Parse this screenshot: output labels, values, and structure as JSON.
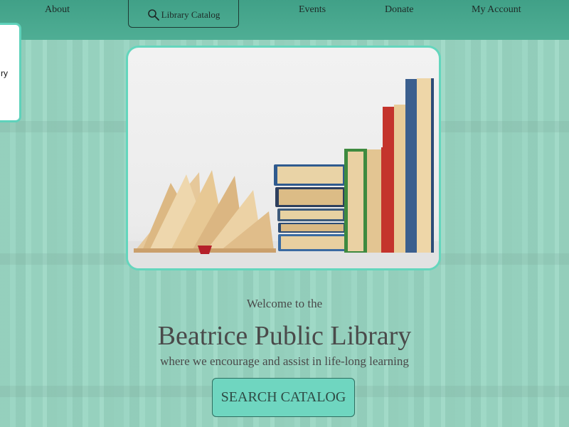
{
  "nav": {
    "about": "About",
    "catalog": "Library Catalog",
    "events": "Events",
    "donate": "Donate",
    "account": "My Account"
  },
  "side_card": {
    "text": "ry"
  },
  "hero": {
    "welcome": "Welcome to the",
    "title": "Beatrice Public Library",
    "tagline": "where we encourage and assist in life-long learning",
    "button": "SEARCH CATALOG"
  },
  "colors": {
    "nav_bg": "#4aa88c",
    "accent": "#64d6bd",
    "button_bg": "#6fd6c0"
  },
  "icons": {
    "catalog": "search-icon"
  }
}
